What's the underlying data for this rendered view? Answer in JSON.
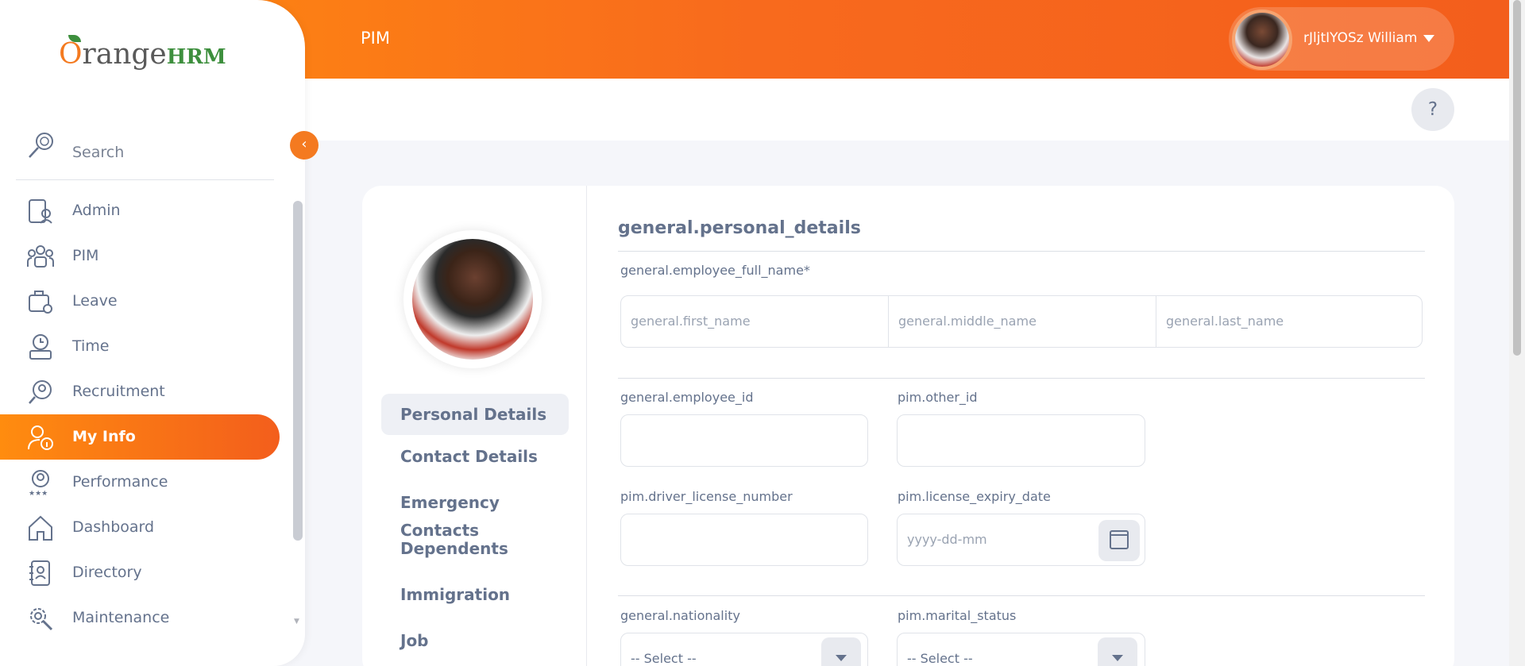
{
  "header": {
    "title": "PIM",
    "user_name": "rJljtIYOSz William",
    "help": "?"
  },
  "sidebar": {
    "logo_text": "range",
    "logo_o": "O",
    "logo_hrm": "HRM",
    "collapse_icon": "‹",
    "search_label": "Search",
    "items": [
      {
        "label": "Admin",
        "icon": "admin-icon"
      },
      {
        "label": "PIM",
        "icon": "pim-icon"
      },
      {
        "label": "Leave",
        "icon": "leave-icon"
      },
      {
        "label": "Time",
        "icon": "time-icon"
      },
      {
        "label": "Recruitment",
        "icon": "recruitment-icon"
      },
      {
        "label": "My Info",
        "icon": "my-info-icon",
        "active": true
      },
      {
        "label": "Performance",
        "icon": "performance-icon"
      },
      {
        "label": "Dashboard",
        "icon": "dashboard-icon"
      },
      {
        "label": "Directory",
        "icon": "directory-icon"
      },
      {
        "label": "Maintenance",
        "icon": "maintenance-icon"
      }
    ]
  },
  "tabs": [
    {
      "label": "Personal Details",
      "active": true
    },
    {
      "label": "Contact Details"
    },
    {
      "label": "Emergency"
    },
    {
      "label": "Dependents"
    },
    {
      "label": "Contacts"
    },
    {
      "label": "Immigration"
    },
    {
      "label": "Job"
    }
  ],
  "form": {
    "section_title": "general.personal_details",
    "full_name_label": "general.employee_full_name*",
    "first_name_placeholder": "general.first_name",
    "middle_name_placeholder": "general.middle_name",
    "last_name_placeholder": "general.last_name",
    "employee_id_label": "general.employee_id",
    "other_id_label": "pim.other_id",
    "driver_license_label": "pim.driver_license_number",
    "license_expiry_label": "pim.license_expiry_date",
    "license_expiry_placeholder": "yyyy-dd-mm",
    "nationality_label": "general.nationality",
    "nationality_value": "-- Select --",
    "marital_status_label": "pim.marital_status",
    "marital_status_value": "-- Select --"
  },
  "colors": {
    "accent": "#f47a20",
    "text": "#64728c"
  }
}
